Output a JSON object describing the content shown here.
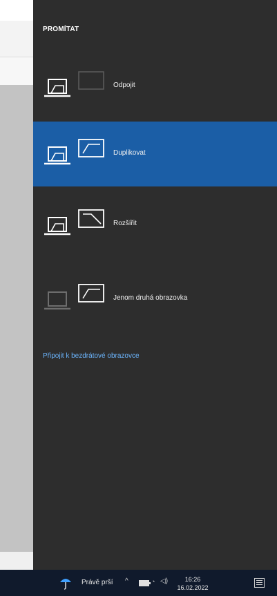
{
  "panel": {
    "title": "PROMÍTAT",
    "options": [
      {
        "label": "Odpojit",
        "icon": "pc-screen-only-icon",
        "selected": false
      },
      {
        "label": "Duplikovat",
        "icon": "duplicate-display-icon",
        "selected": true
      },
      {
        "label": "Rozšířit",
        "icon": "extend-display-icon",
        "selected": false
      },
      {
        "label": "Jenom druhá obrazovka",
        "icon": "second-screen-only-icon",
        "selected": false
      }
    ],
    "wireless_link": "Připojit k bezdrátové obrazovce"
  },
  "taskbar": {
    "weather": "Právě prší",
    "chevron": "^",
    "time": "16:26",
    "date": "16.02.2022"
  },
  "colors": {
    "panel_bg": "#2d2d2d",
    "selected_bg": "#1b5ea6",
    "link": "#6cb6ff",
    "taskbar_bg": "#101a2c"
  }
}
